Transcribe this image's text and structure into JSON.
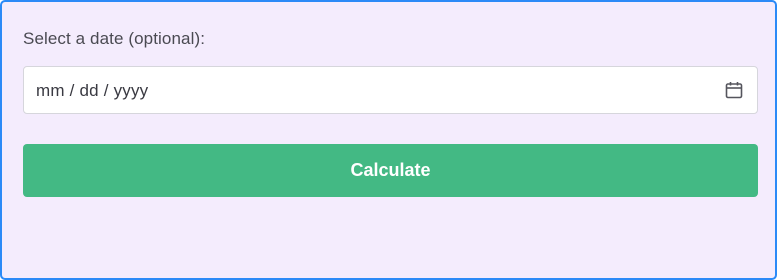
{
  "form": {
    "date_label": "Select a date (optional):",
    "date_placeholder": "mm / dd / yyyy",
    "calendar_icon": "calendar-icon",
    "submit_label": "Calculate"
  },
  "colors": {
    "panel_background": "#f4ecfd",
    "panel_border": "#2b8af7",
    "button_background": "#43b984",
    "button_text": "#ffffff"
  }
}
